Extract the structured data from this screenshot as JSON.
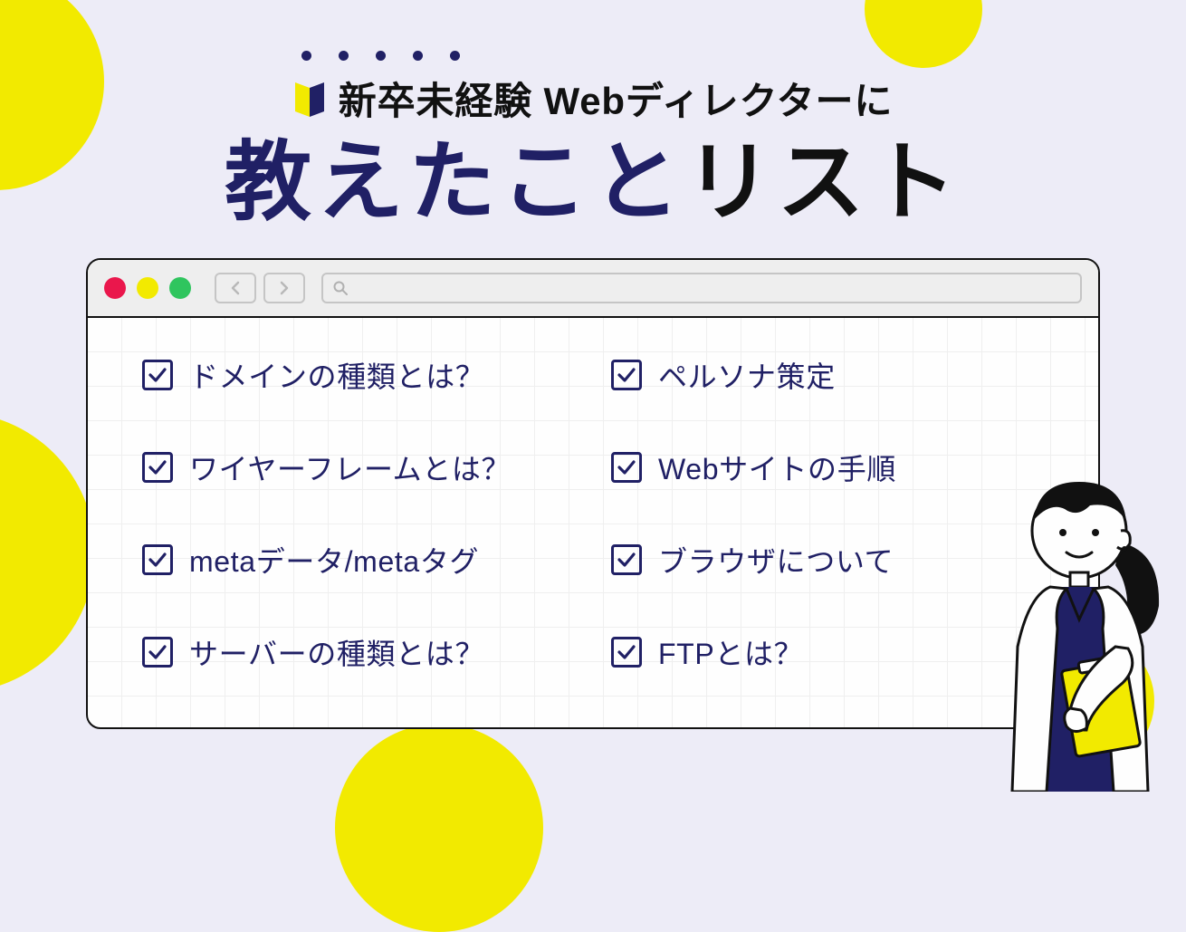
{
  "colors": {
    "navy": "#202065",
    "yellow": "#f2ea00",
    "bg": "#edecf7"
  },
  "header": {
    "subtitle": "新卒未経験 Webディレクターに",
    "title_navy": "教えたこと",
    "title_black": "リスト"
  },
  "browser": {
    "search_placeholder": ""
  },
  "list": {
    "left": [
      {
        "label": "ドメインの種類とは？",
        "checked": true
      },
      {
        "label": "ワイヤーフレームとは？",
        "checked": true
      },
      {
        "label": "metaデータ/metaタグ",
        "checked": true
      },
      {
        "label": "サーバーの種類とは？",
        "checked": true
      }
    ],
    "right": [
      {
        "label": "ペルソナ策定",
        "checked": true
      },
      {
        "label": "Webサイトの手順",
        "checked": true
      },
      {
        "label": "ブラウザについて",
        "checked": true
      },
      {
        "label": "FTPとは？",
        "checked": true
      }
    ]
  }
}
